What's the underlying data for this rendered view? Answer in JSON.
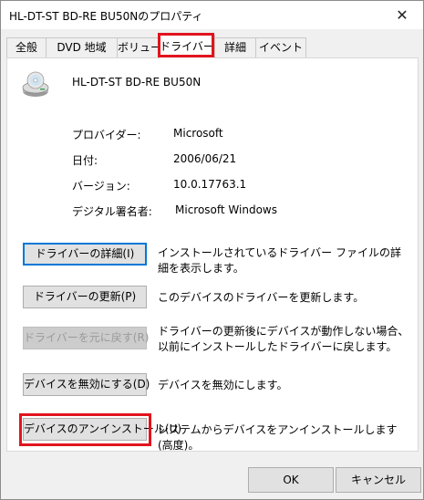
{
  "window": {
    "title": "HL-DT-ST BD-RE BU50Nのプロパティ",
    "close_glyph": "✕"
  },
  "tabs": [
    {
      "label": "全般"
    },
    {
      "label": "DVD 地域"
    },
    {
      "label": "ボリューム"
    },
    {
      "label": "ドライバー",
      "active": true
    },
    {
      "label": "詳細"
    },
    {
      "label": "イベント"
    }
  ],
  "device": {
    "name": "HL-DT-ST BD-RE BU50N",
    "icon": "optical-drive-icon"
  },
  "properties": [
    {
      "label": "プロバイダー:",
      "value": "Microsoft"
    },
    {
      "label": "日付:",
      "value": "2006/06/21"
    },
    {
      "label": "バージョン:",
      "value": "10.0.17763.1"
    },
    {
      "label": "デジタル署名者:",
      "value": "Microsoft Windows"
    }
  ],
  "actions": [
    {
      "label": "ドライバーの詳細(I)",
      "desc": "インストールされているドライバー ファイルの詳細を表示します。",
      "enabled": true
    },
    {
      "label": "ドライバーの更新(P)",
      "desc": "このデバイスのドライバーを更新します。",
      "enabled": true
    },
    {
      "label": "ドライバーを元に戻す(R)",
      "desc": "ドライバーの更新後にデバイスが動作しない場合、以前にインストールしたドライバーに戻します。",
      "enabled": false
    },
    {
      "label": "デバイスを無効にする(D)",
      "desc": "デバイスを無効にします。",
      "enabled": true
    },
    {
      "label": "デバイスのアンインストール(U)",
      "desc": "システムからデバイスをアンインストールします (高度)。",
      "enabled": true
    }
  ],
  "footer": {
    "ok_label": "OK",
    "cancel_label": "キャンセル"
  },
  "colors": {
    "highlight": "#e1141e",
    "focus": "#0078d7"
  }
}
